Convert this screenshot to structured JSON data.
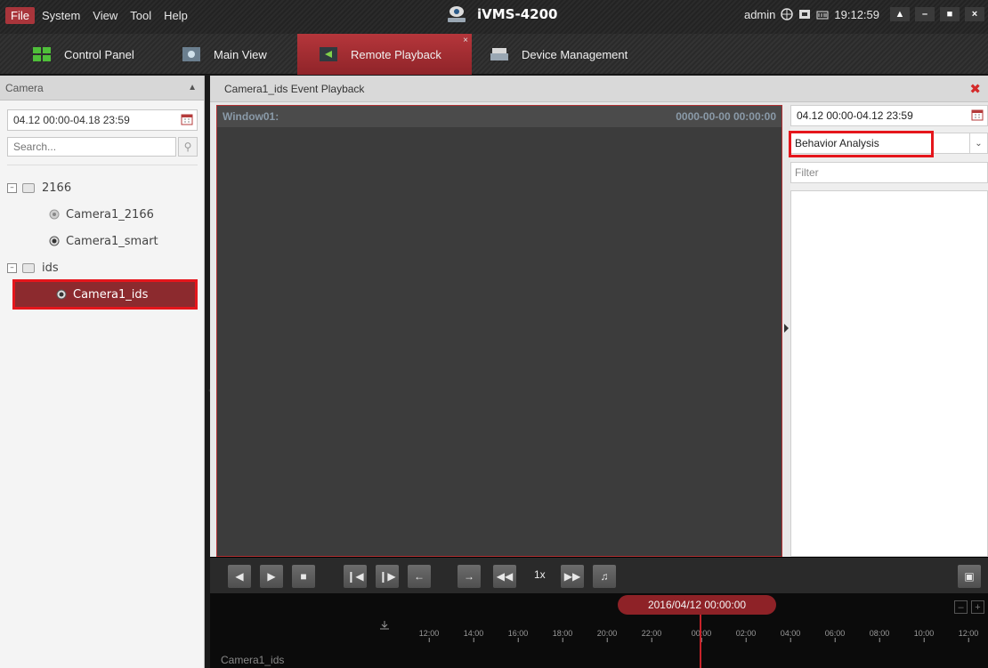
{
  "menubar": {
    "items": [
      "File",
      "System",
      "View",
      "Tool",
      "Help"
    ],
    "app_title": "iVMS-4200",
    "user": "admin",
    "clock": "19:12:59"
  },
  "tabs": [
    {
      "label": "Control Panel",
      "icon": "control-panel-icon"
    },
    {
      "label": "Main View",
      "icon": "main-view-icon"
    },
    {
      "label": "Remote Playback",
      "icon": "remote-playback-icon",
      "active": true
    },
    {
      "label": "Device Management",
      "icon": "device-management-icon"
    }
  ],
  "left": {
    "header": "Camera",
    "date_range": "04.12 00:00-04.18 23:59",
    "search_placeholder": "Search...",
    "tree": [
      {
        "label": "2166",
        "type": "group"
      },
      {
        "label": "Camera1_2166",
        "type": "camera"
      },
      {
        "label": "Camera1_smart",
        "type": "camera"
      },
      {
        "label": "ids",
        "type": "group"
      },
      {
        "label": "Camera1_ids",
        "type": "camera",
        "selected": true
      }
    ]
  },
  "main": {
    "title": "Camera1_ids Event Playback",
    "window_label": "Window01:",
    "window_time": "0000-00-00 00:00:00"
  },
  "event_panel": {
    "date_range": "04.12 00:00-04.12 23:59",
    "event_type": "Behavior Analysis",
    "filter_placeholder": "Filter"
  },
  "toolbar": {
    "speed": "1x"
  },
  "timeline": {
    "current": "2016/04/12 00:00:00",
    "ticks": [
      "12:00",
      "14:00",
      "16:00",
      "18:00",
      "20:00",
      "22:00",
      "00:00",
      "02:00",
      "04:00",
      "06:00",
      "08:00",
      "10:00",
      "12:00"
    ],
    "camera_label": "Camera1_ids"
  },
  "colors": {
    "accent": "#a9353b",
    "highlight": "#e5161c",
    "timeline_cursor": "#c8232a"
  }
}
